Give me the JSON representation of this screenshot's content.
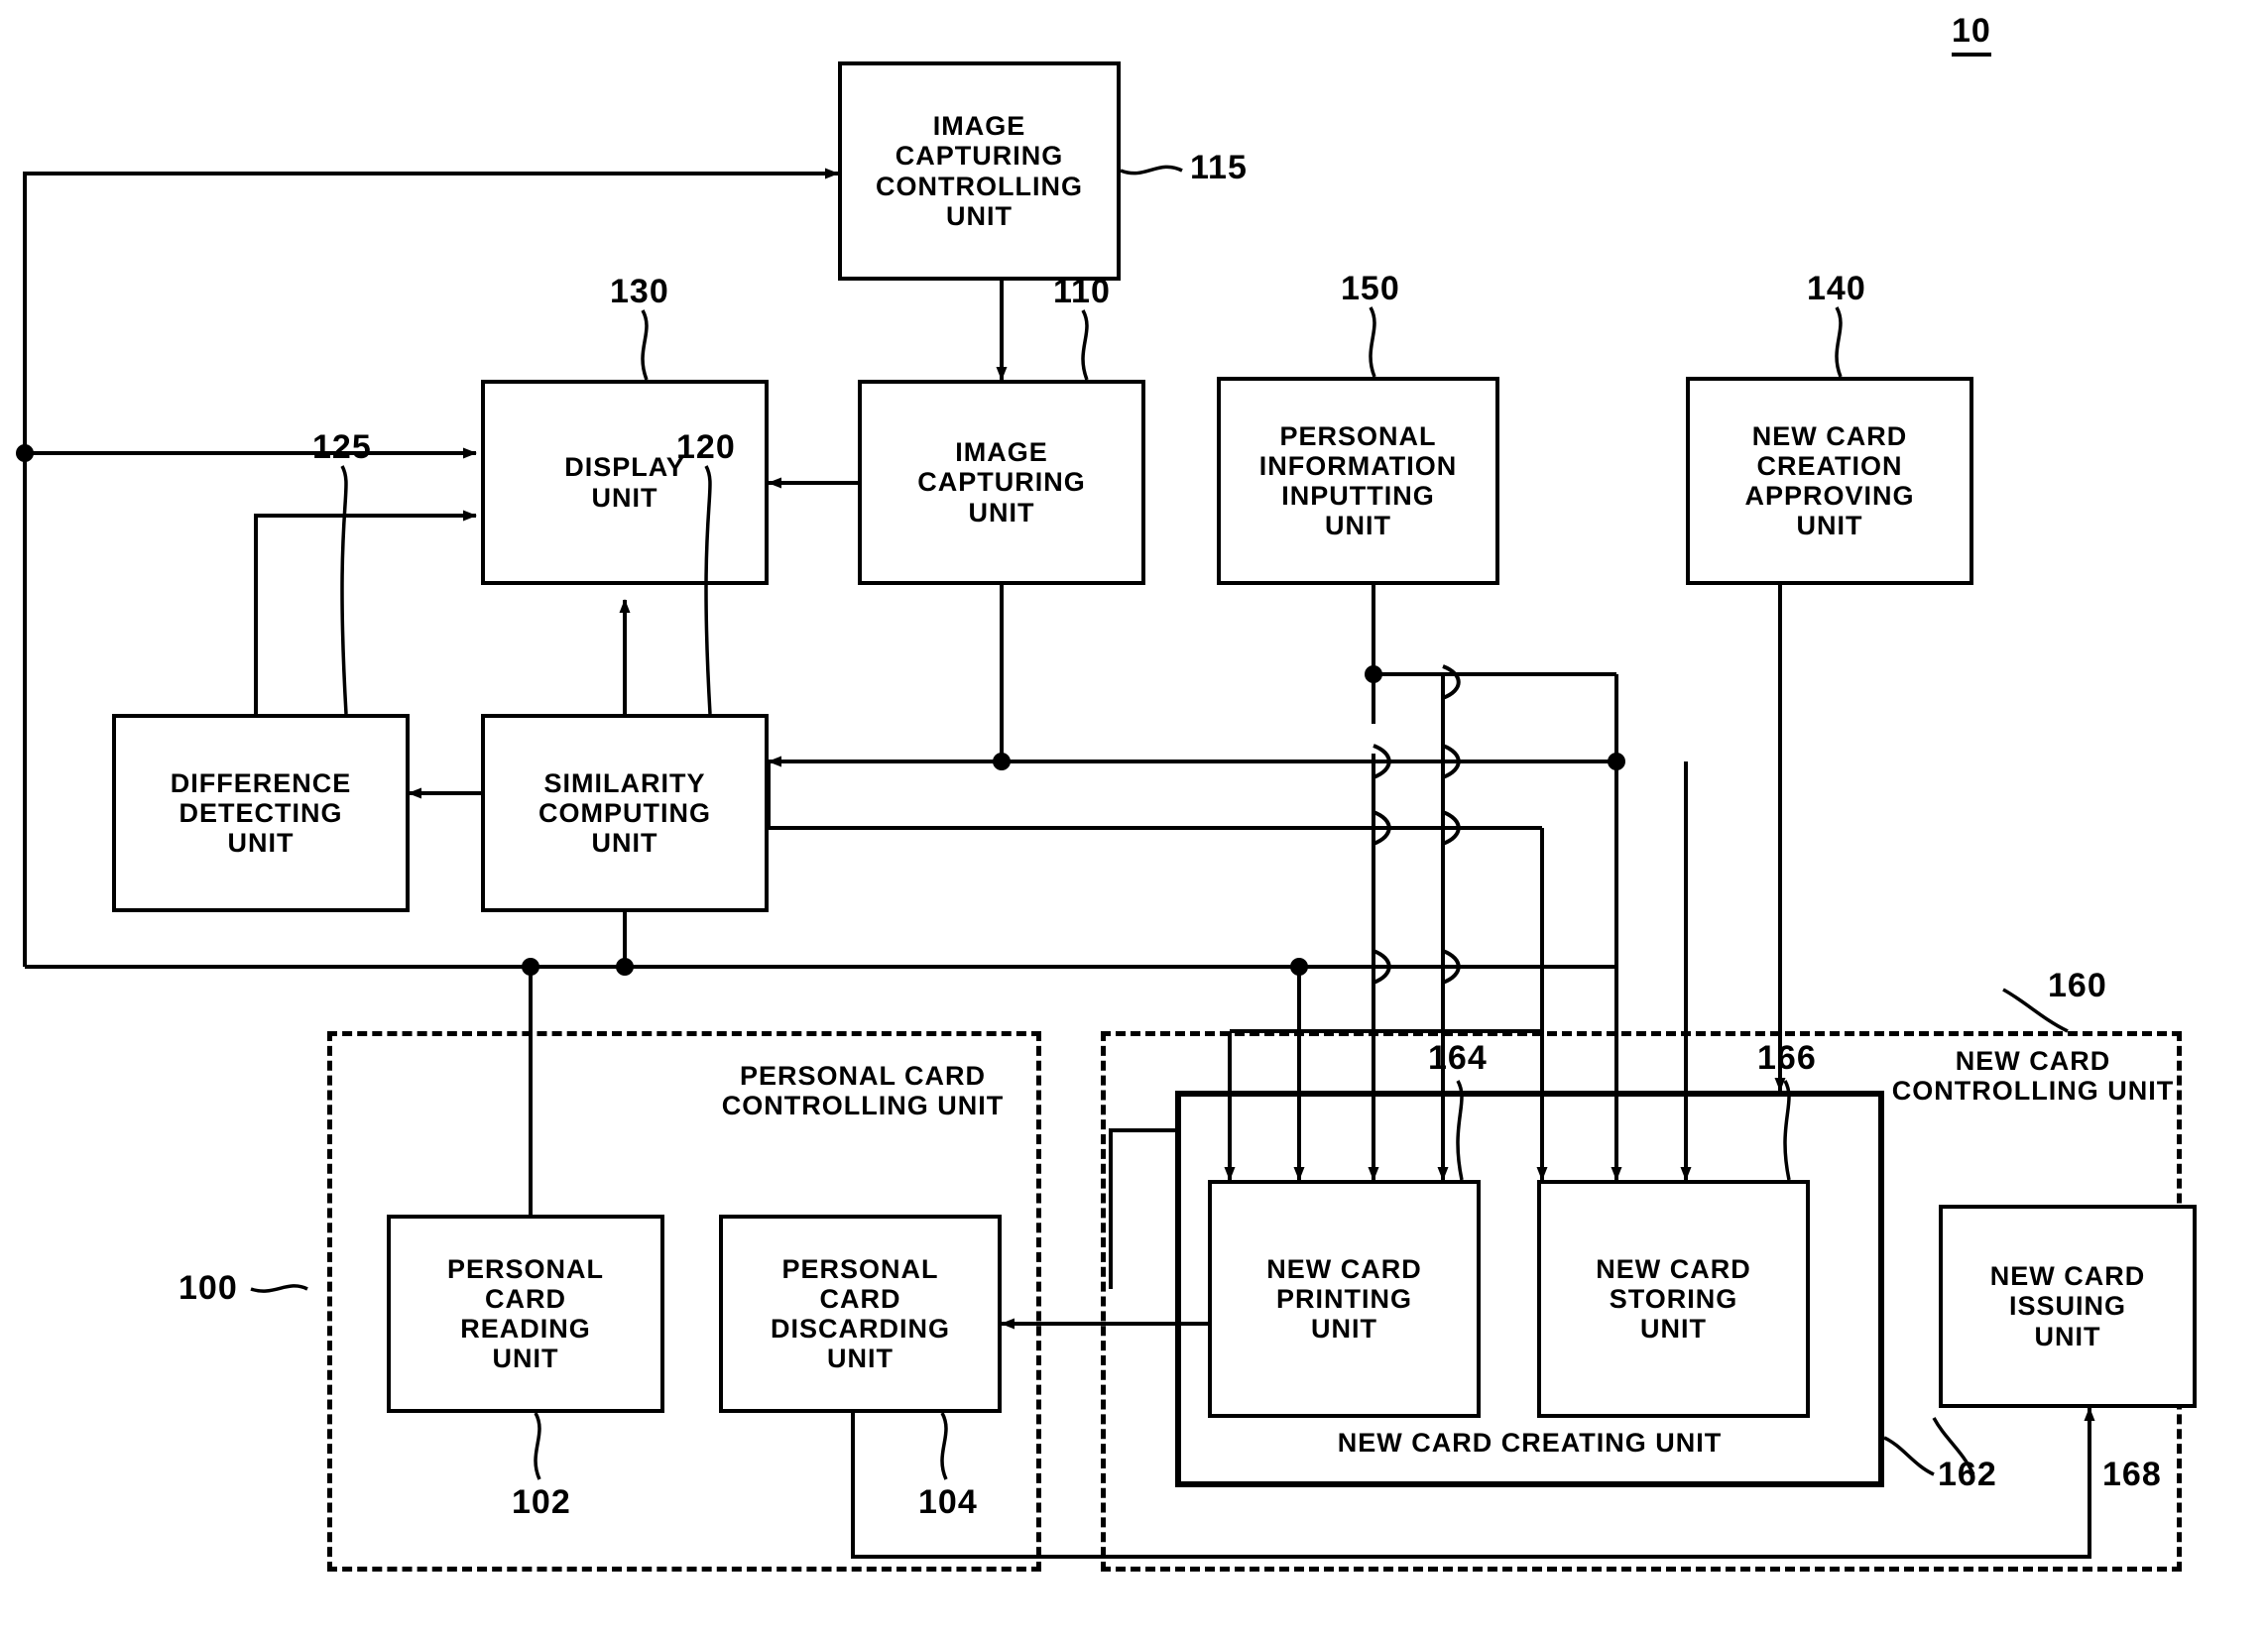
{
  "figure": {
    "number": "10"
  },
  "blocks": [
    {
      "id": "image-capturing-controlling-unit",
      "label": "IMAGE\nCAPTURING\nCONTROLLING\nUNIT",
      "ref": "115"
    },
    {
      "id": "display-unit",
      "label": "DISPLAY\nUNIT",
      "ref": "130"
    },
    {
      "id": "image-capturing-unit",
      "label": "IMAGE\nCAPTURING\nUNIT",
      "ref": "110"
    },
    {
      "id": "personal-information-inputting-unit",
      "label": "PERSONAL\nINFORMATION\nINPUTTING\nUNIT",
      "ref": "150"
    },
    {
      "id": "new-card-creation-approving-unit",
      "label": "NEW CARD\nCREATION\nAPPROVING\nUNIT",
      "ref": "140"
    },
    {
      "id": "difference-detecting-unit",
      "label": "DIFFERENCE\nDETECTING\nUNIT",
      "ref": "125"
    },
    {
      "id": "similarity-computing-unit",
      "label": "SIMILARITY\nCOMPUTING\nUNIT",
      "ref": "120"
    },
    {
      "id": "personal-card-reading-unit",
      "label": "PERSONAL\nCARD\nREADING\nUNIT",
      "ref": "102"
    },
    {
      "id": "personal-card-discarding-unit",
      "label": "PERSONAL\nCARD\nDISCARDING\nUNIT",
      "ref": "104"
    },
    {
      "id": "new-card-printing-unit",
      "label": "NEW CARD\nPRINTING\nUNIT",
      "ref": "164"
    },
    {
      "id": "new-card-storing-unit",
      "label": "NEW CARD\nSTORING\nUNIT",
      "ref": "166"
    },
    {
      "id": "new-card-issuing-unit",
      "label": "NEW CARD\nISSUING\nUNIT",
      "ref": "168"
    }
  ],
  "containers": [
    {
      "id": "personal-card-controlling-unit",
      "label": "PERSONAL CARD\nCONTROLLING UNIT",
      "ref": "100"
    },
    {
      "id": "new-card-controlling-unit",
      "label": "NEW CARD\nCONTROLLING UNIT",
      "ref": "160"
    },
    {
      "id": "new-card-creating-unit",
      "label": "NEW CARD CREATING UNIT",
      "ref": "162"
    }
  ],
  "text": {
    "b115_label": "IMAGE\nCAPTURING\nCONTROLLING\nUNIT",
    "b115_ref": "115",
    "b130_label": "DISPLAY\nUNIT",
    "b130_ref": "130",
    "b110_label": "IMAGE\nCAPTURING\nUNIT",
    "b110_ref": "110",
    "b150_label": "PERSONAL\nINFORMATION\nINPUTTING\nUNIT",
    "b150_ref": "150",
    "b140_label": "NEW CARD\nCREATION\nAPPROVING\nUNIT",
    "b140_ref": "140",
    "b125_label": "DIFFERENCE\nDETECTING\nUNIT",
    "b125_ref": "125",
    "b120_label": "SIMILARITY\nCOMPUTING\nUNIT",
    "b120_ref": "120",
    "b102_label": "PERSONAL\nCARD\nREADING\nUNIT",
    "b102_ref": "102",
    "b104_label": "PERSONAL\nCARD\nDISCARDING\nUNIT",
    "b104_ref": "104",
    "b164_label": "NEW CARD\nPRINTING\nUNIT",
    "b164_ref": "164",
    "b166_label": "NEW CARD\nSTORING\nUNIT",
    "b166_ref": "166",
    "b168_label": "NEW CARD\nISSUING\nUNIT",
    "b168_ref": "168",
    "pccu_label": "PERSONAL CARD\nCONTROLLING UNIT",
    "pccu_ref": "100",
    "nccu_label": "NEW CARD\nCONTROLLING UNIT",
    "nccu_ref": "160",
    "nccreate_label": "NEW CARD CREATING UNIT",
    "nccreate_ref": "162",
    "fig_number": "10"
  },
  "colors": {
    "stroke": "#000000",
    "background": "#ffffff"
  }
}
